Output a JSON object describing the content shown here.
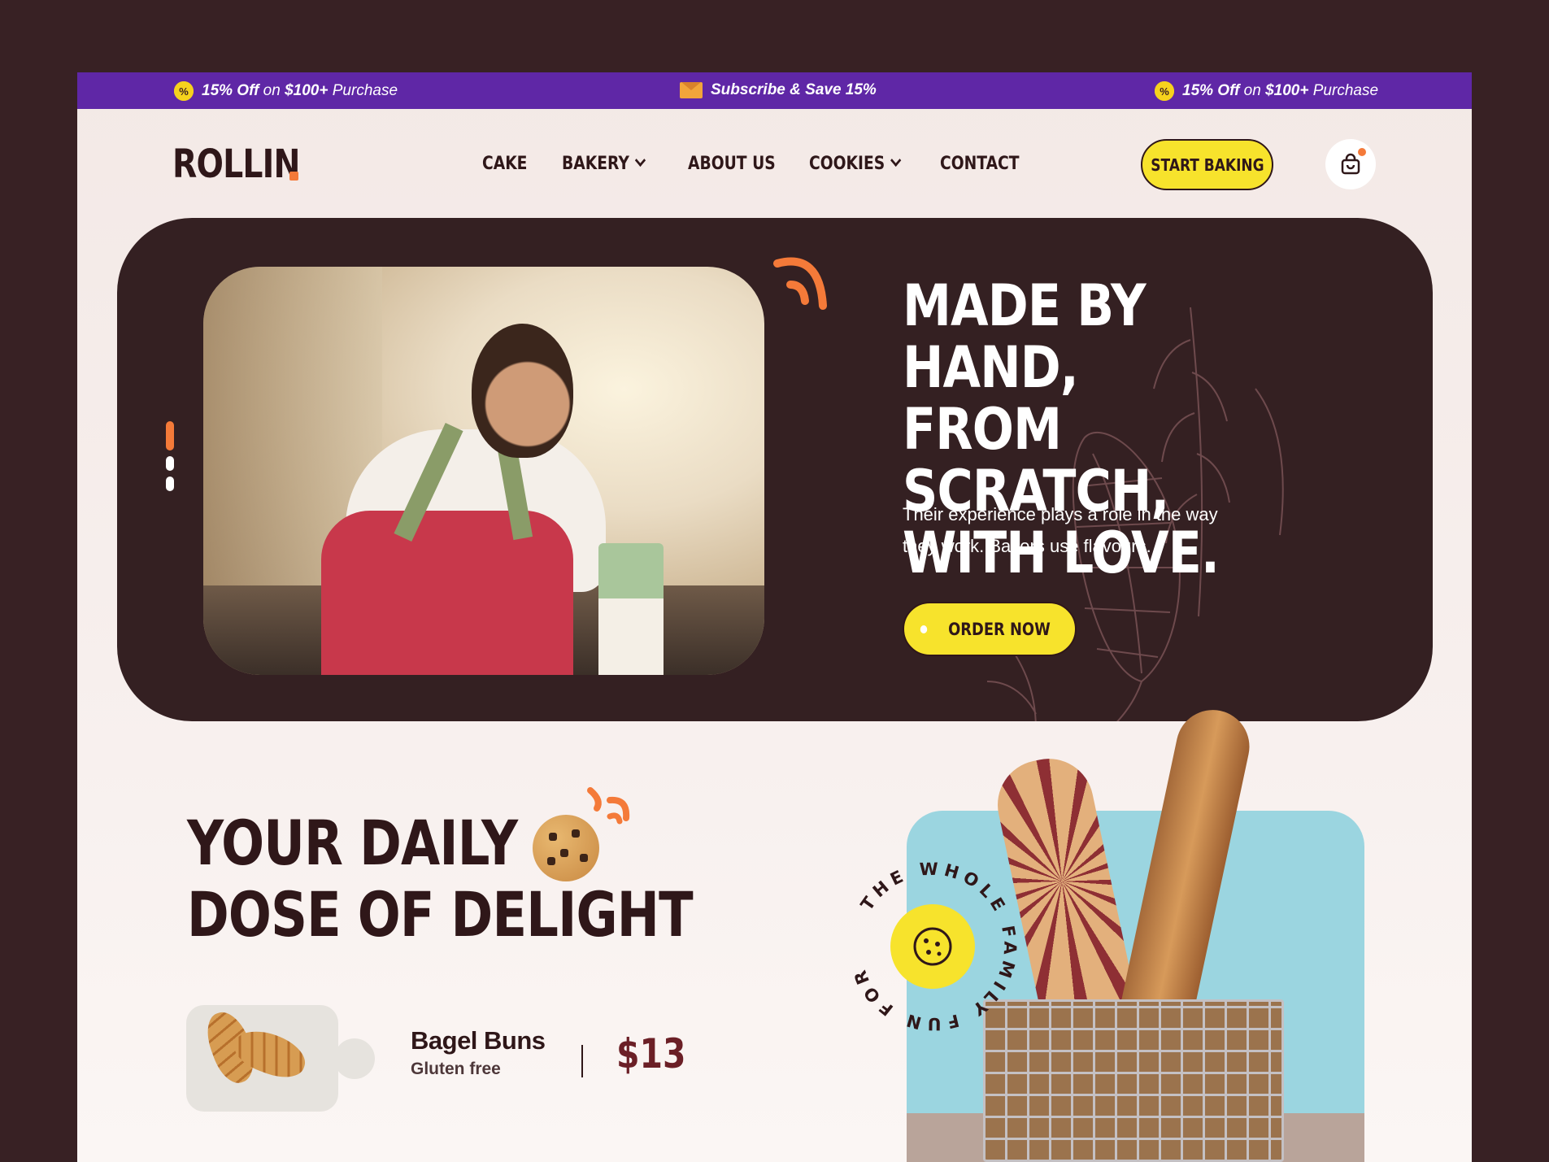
{
  "promo": {
    "left": {
      "bold": "15% Off",
      "mid": " on ",
      "amount": "$100+",
      "rest": " Purchase"
    },
    "center": {
      "text": "Subscribe & Save 15%"
    },
    "right": {
      "bold": "15% Off",
      "mid": " on ",
      "amount": "$100+",
      "rest": " Purchase"
    }
  },
  "header": {
    "logo": "ROLLIN",
    "nav": [
      {
        "label": "CAKE",
        "dropdown": false
      },
      {
        "label": "BAKERY",
        "dropdown": true
      },
      {
        "label": "ABOUT US",
        "dropdown": false
      },
      {
        "label": "COOKIES",
        "dropdown": true
      },
      {
        "label": "CONTACT",
        "dropdown": false
      }
    ],
    "cta": "START BAKING",
    "cart_icon": "shopping-bag-icon"
  },
  "hero": {
    "title_lines": [
      "MADE BY HAND,",
      "FROM SCRATCH,",
      "WITH LOVE."
    ],
    "subtitle": "Their experience plays a role in the way they work. Bakers use flavours.",
    "button": "ORDER NOW",
    "slides_total": 3,
    "slide_active": 1
  },
  "section": {
    "title_line1": "YOUR DAILY",
    "title_line2": "DOSE OF DELIGHT",
    "product": {
      "name": "Bagel Buns",
      "subtitle": "Gluten free",
      "price": "$13"
    },
    "stamp_text": "THE WHOLE FAMILY FUN FOR"
  },
  "colors": {
    "background": "#382124",
    "promo_bar": "#5f27a6",
    "accent_yellow": "#f7e32c",
    "accent_orange": "#f47a39",
    "hero_bg": "#342022",
    "blue_card": "#9bd5e0"
  }
}
